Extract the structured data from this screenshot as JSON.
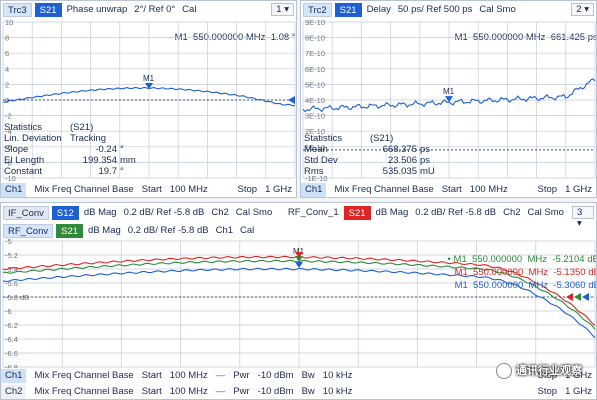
{
  "top_left": {
    "trace": "Trc3",
    "param": "S21",
    "format": "Phase unwrap",
    "scale": "2°/ Ref 0°",
    "cal": "Cal",
    "window_num": "1",
    "marker": {
      "name": "M1",
      "freq": "550.000000",
      "unit": "MHz",
      "value": "1.08",
      "vunit": "°"
    },
    "y_ticks": [
      "10",
      "8",
      "6",
      "4",
      "2",
      "0",
      "-2",
      "-4",
      "-6",
      "-8",
      "-10"
    ],
    "ref_label": "0°",
    "marker_tag": "M1",
    "stats_title": "Statistics",
    "stats_param": "(S21)",
    "stats_sub": "Lin. Deviation",
    "stats_mode": "Tracking",
    "stats": [
      {
        "k": "Slope",
        "v": "-0.24",
        "u": "°"
      },
      {
        "k": "El Length",
        "v": "199.354",
        "u": "mm"
      },
      {
        "k": "Constant",
        "v": "19.7",
        "u": "°"
      }
    ],
    "footer": {
      "ch": "Ch1",
      "mode": "Mix Freq Channel Base",
      "start_label": "Start",
      "start": "100 MHz",
      "stop_label": "Stop",
      "stop": "1 GHz"
    }
  },
  "top_right": {
    "trace": "Trc2",
    "param": "S21",
    "format": "Delay",
    "scale": "50 ps/ Ref 500 ps",
    "cal": "Cal Smo",
    "window_num": "2",
    "marker": {
      "name": "M1",
      "freq": "550.000000",
      "unit": "MHz",
      "value": "661.425",
      "vunit": "ps"
    },
    "y_ticks": [
      "9E-10",
      "8E-10",
      "7E-10",
      "6E-10",
      "5E-10",
      "4E-10",
      "3E-10",
      "2E-10",
      "1E-10",
      "",
      "-1E-10"
    ],
    "marker_tag": "M1",
    "stats_title": "Statistics",
    "stats_param": "(S21)",
    "stats": [
      {
        "k": "Mean",
        "v": "668.375",
        "u": "ps"
      },
      {
        "k": "Std Dev",
        "v": "23.506",
        "u": "ps"
      },
      {
        "k": "Rms",
        "v": "535.035",
        "u": "mU"
      }
    ],
    "footer": {
      "ch": "Ch1",
      "mode": "Mix Freq Channel Base",
      "start_label": "Start",
      "start": "100 MHz",
      "stop_label": "Stop",
      "stop": "1 GHz"
    }
  },
  "bottom": {
    "row1": [
      {
        "name": "IF_Conv",
        "param": "S12",
        "format": "dB Mag",
        "scale": "0.2 dB/ Ref -5.8 dB",
        "ch": "Ch2",
        "cal": "Cal Smo"
      },
      {
        "name": "RF_Conv_1",
        "param": "S21",
        "format": "dB Mag",
        "scale": "0.2 dB/ Ref -5.8 dB",
        "ch": "Ch2",
        "cal": "Cal Smo"
      }
    ],
    "row2": {
      "name": "RF_Conv",
      "param": "S21",
      "format": "dB Mag",
      "scale": "0.2 dB/ Ref -5.8 dB",
      "ch": "Ch1",
      "cal": "Cal"
    },
    "window_num": "3",
    "markers": [
      {
        "name": "M1",
        "freq": "550.000000",
        "unit": "MHz",
        "value": "-5.2104",
        "vunit": "dB",
        "color": "#2e8b3a"
      },
      {
        "name": "M1",
        "freq": "550.000000",
        "unit": "MHz",
        "value": "-5.1350",
        "vunit": "dB",
        "color": "#e02424"
      },
      {
        "name": "M1",
        "freq": "550.000000",
        "unit": "MHz",
        "value": "-5.3060",
        "vunit": "dB",
        "color": "#1f5fd6"
      }
    ],
    "y_ticks": [
      "-5",
      "-5.2",
      "-5.4",
      "-5.6",
      "-5.8 dB",
      "-6",
      "-6.2",
      "-6.4",
      "-6.6",
      "-6.8"
    ],
    "marker_tag": "M1",
    "footer1": {
      "ch": "Ch1",
      "mode": "Mix Freq Channel Base",
      "start_label": "Start",
      "start": "100 MHz",
      "pwr_label": "Pwr",
      "pwr": "-10 dBm",
      "bw_label": "Bw",
      "bw": "10 kHz",
      "stop_label": "Stop",
      "stop": "1 GHz"
    },
    "footer2": {
      "ch": "Ch2",
      "mode": "Mix Freq Channel Base",
      "start_label": "Start",
      "start": "100 MHz",
      "pwr_label": "Pwr",
      "pwr": "-10 dBm",
      "bw_label": "Bw",
      "bw": "10 kHz",
      "stop_label": "Stop",
      "stop": "1 GHz"
    }
  },
  "watermark": "通讯行业观察",
  "colors": {
    "blue": "#1f5fd6",
    "red": "#e02424",
    "green": "#2e8b3a",
    "grid": "#b8c2d2",
    "tab_bg": "#e2e8f2"
  }
}
